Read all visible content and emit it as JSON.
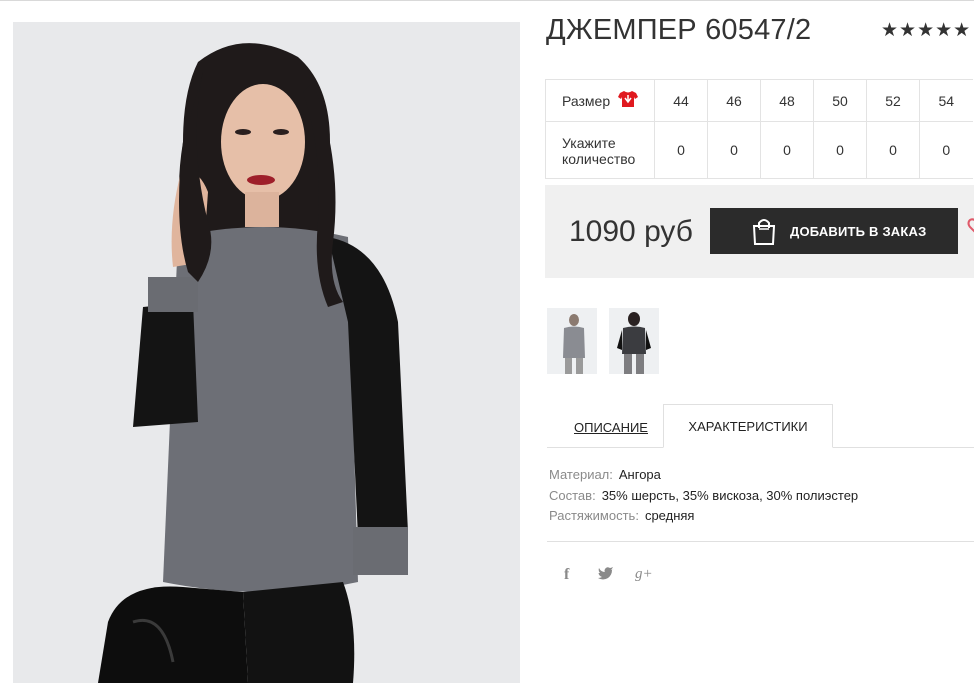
{
  "product": {
    "title": "ДЖЕМПЕР 60547/2",
    "rating_stars": "★★★★★"
  },
  "size_table": {
    "size_label": "Размер",
    "qty_label": "Укажите количество",
    "sizes": [
      "44",
      "46",
      "48",
      "50",
      "52",
      "54"
    ],
    "quantities": [
      "0",
      "0",
      "0",
      "0",
      "0",
      "0"
    ]
  },
  "buy": {
    "price": "1090 руб",
    "add_button": "ДОБАВИТЬ В ЗАКАЗ"
  },
  "tabs": {
    "description": "ОПИСАНИЕ",
    "characteristics": "ХАРАКТЕРИСТИКИ"
  },
  "specs": [
    {
      "key": "Материал:",
      "value": "Ангора"
    },
    {
      "key": "Состав:",
      "value": "35% шерсть, 35% вискоза, 30% полиэстер"
    },
    {
      "key": "Растяжимость:",
      "value": "средняя"
    }
  ],
  "social": {
    "facebook": "f",
    "twitter": "🐦",
    "google": "g+"
  },
  "colors": {
    "button_bg": "#2b2b2b",
    "panel_bg": "#f0f0f0",
    "size_icon": "#e0191f",
    "heart": "#e05a6a"
  }
}
